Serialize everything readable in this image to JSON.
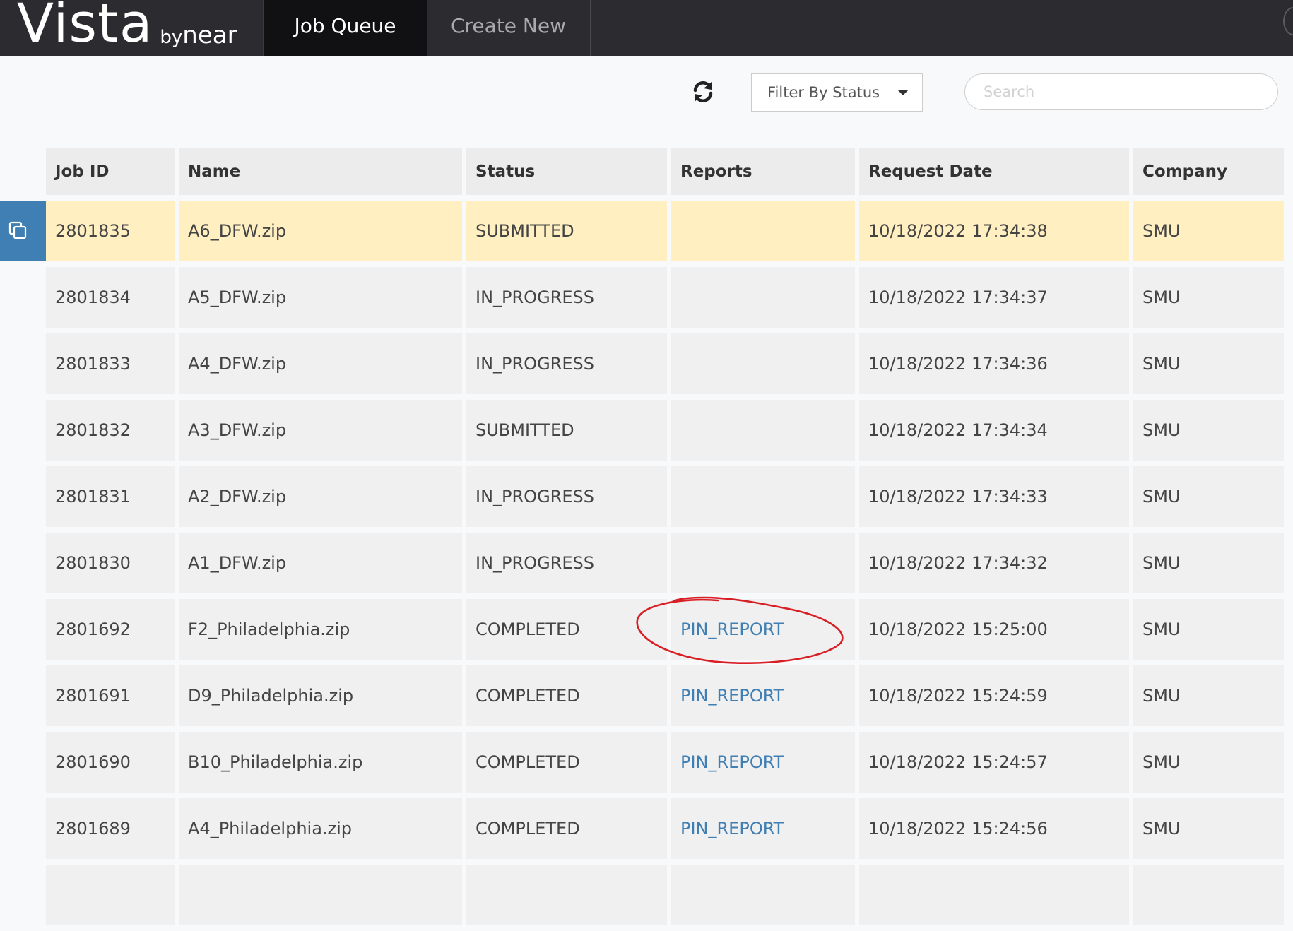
{
  "header": {
    "brand_main": "Vista",
    "brand_by": "by",
    "brand_near": "near",
    "tabs": [
      {
        "label": "Job Queue",
        "active": true
      },
      {
        "label": "Create New",
        "active": false
      }
    ]
  },
  "toolbar": {
    "refresh_icon": "refresh-icon",
    "filter_label": "Filter By Status",
    "search_placeholder": "Search"
  },
  "table": {
    "columns": [
      "Job ID",
      "Name",
      "Status",
      "Reports",
      "Request Date",
      "Company"
    ],
    "rows": [
      {
        "job_id": "2801835",
        "name": "A6_DFW.zip",
        "status": "SUBMITTED",
        "report": "",
        "date": "10/18/2022 17:34:38",
        "company": "SMU",
        "selected": true
      },
      {
        "job_id": "2801834",
        "name": "A5_DFW.zip",
        "status": "IN_PROGRESS",
        "report": "",
        "date": "10/18/2022 17:34:37",
        "company": "SMU"
      },
      {
        "job_id": "2801833",
        "name": "A4_DFW.zip",
        "status": "IN_PROGRESS",
        "report": "",
        "date": "10/18/2022 17:34:36",
        "company": "SMU"
      },
      {
        "job_id": "2801832",
        "name": "A3_DFW.zip",
        "status": "SUBMITTED",
        "report": "",
        "date": "10/18/2022 17:34:34",
        "company": "SMU"
      },
      {
        "job_id": "2801831",
        "name": "A2_DFW.zip",
        "status": "IN_PROGRESS",
        "report": "",
        "date": "10/18/2022 17:34:33",
        "company": "SMU"
      },
      {
        "job_id": "2801830",
        "name": "A1_DFW.zip",
        "status": "IN_PROGRESS",
        "report": "",
        "date": "10/18/2022 17:34:32",
        "company": "SMU"
      },
      {
        "job_id": "2801692",
        "name": "F2_Philadelphia.zip",
        "status": "COMPLETED",
        "report": "PIN_REPORT",
        "date": "10/18/2022 15:25:00",
        "company": "SMU"
      },
      {
        "job_id": "2801691",
        "name": "D9_Philadelphia.zip",
        "status": "COMPLETED",
        "report": "PIN_REPORT",
        "date": "10/18/2022 15:24:59",
        "company": "SMU"
      },
      {
        "job_id": "2801690",
        "name": "B10_Philadelphia.zip",
        "status": "COMPLETED",
        "report": "PIN_REPORT",
        "date": "10/18/2022 15:24:57",
        "company": "SMU"
      },
      {
        "job_id": "2801689",
        "name": "A4_Philadelphia.zip",
        "status": "COMPLETED",
        "report": "PIN_REPORT",
        "date": "10/18/2022 15:24:56",
        "company": "SMU"
      },
      {
        "job_id": "",
        "name": "",
        "status": "",
        "report": "",
        "date": "",
        "company": ""
      }
    ]
  },
  "colors": {
    "topbar": "#2b2b30",
    "active_tab": "#111113",
    "selected_row": "#ffefc1",
    "link": "#3f7fb3",
    "annotation": "#d81f26"
  }
}
